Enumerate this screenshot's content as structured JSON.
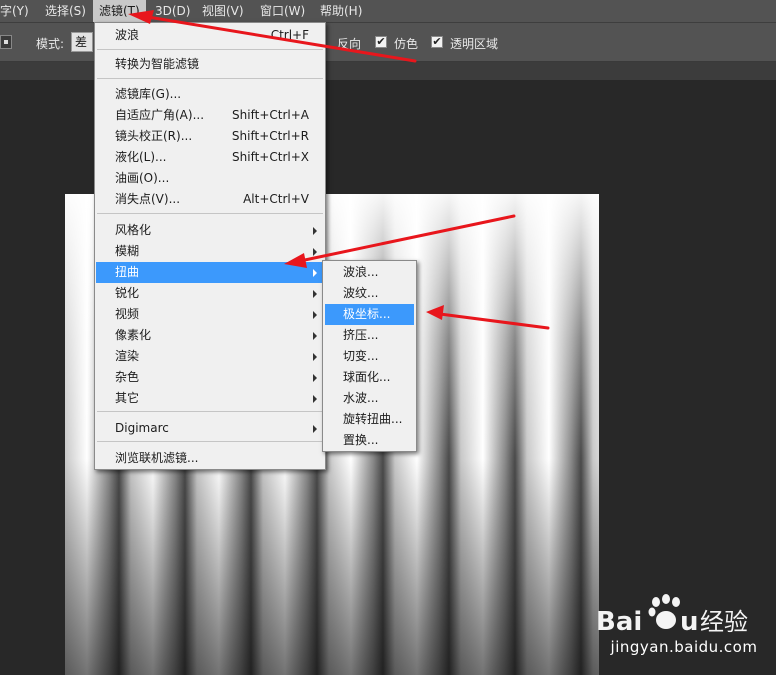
{
  "menubar": {
    "items": [
      "字(Y)",
      "选择(S)",
      "滤镜(T)",
      "3D(D)",
      "视图(V)",
      "窗口(W)",
      "帮助(H)"
    ],
    "active_index": 2
  },
  "optionsbar": {
    "mode_label": "模式:",
    "mode_value": "差",
    "reverse_label": "反向",
    "dither_label": "仿色",
    "dither_checked": true,
    "transparency_label": "透明区域",
    "transparency_checked": true
  },
  "filter_menu": {
    "last_filter": {
      "label": "波浪",
      "shortcut": "Ctrl+F"
    },
    "smart_filters": "转换为智能滤镜",
    "filter_gallery": "滤镜库(G)...",
    "adaptive_wide_angle": {
      "label": "自适应广角(A)...",
      "shortcut": "Shift+Ctrl+A"
    },
    "lens_correction": {
      "label": "镜头校正(R)...",
      "shortcut": "Shift+Ctrl+R"
    },
    "liquify": {
      "label": "液化(L)...",
      "shortcut": "Shift+Ctrl+X"
    },
    "oil_paint": {
      "label": "油画(O)..."
    },
    "vanishing_point": {
      "label": "消失点(V)...",
      "shortcut": "Alt+Ctrl+V"
    },
    "categories": [
      "风格化",
      "模糊",
      "扭曲",
      "锐化",
      "视频",
      "像素化",
      "渲染",
      "杂色",
      "其它"
    ],
    "highlighted_category": "扭曲",
    "digimarc": "Digimarc",
    "browse_online": "浏览联机滤镜..."
  },
  "distort_submenu": {
    "items": [
      "波浪...",
      "波纹...",
      "极坐标...",
      "挤压...",
      "切变...",
      "球面化...",
      "水波...",
      "旋转扭曲...",
      "置换..."
    ],
    "highlighted": "极坐标..."
  },
  "annotation_color": "#e8161c",
  "menu_highlight_color": "#3c99fc",
  "watermark": {
    "logo_text": "Bai经验",
    "url": "jingyan.baidu.com"
  }
}
